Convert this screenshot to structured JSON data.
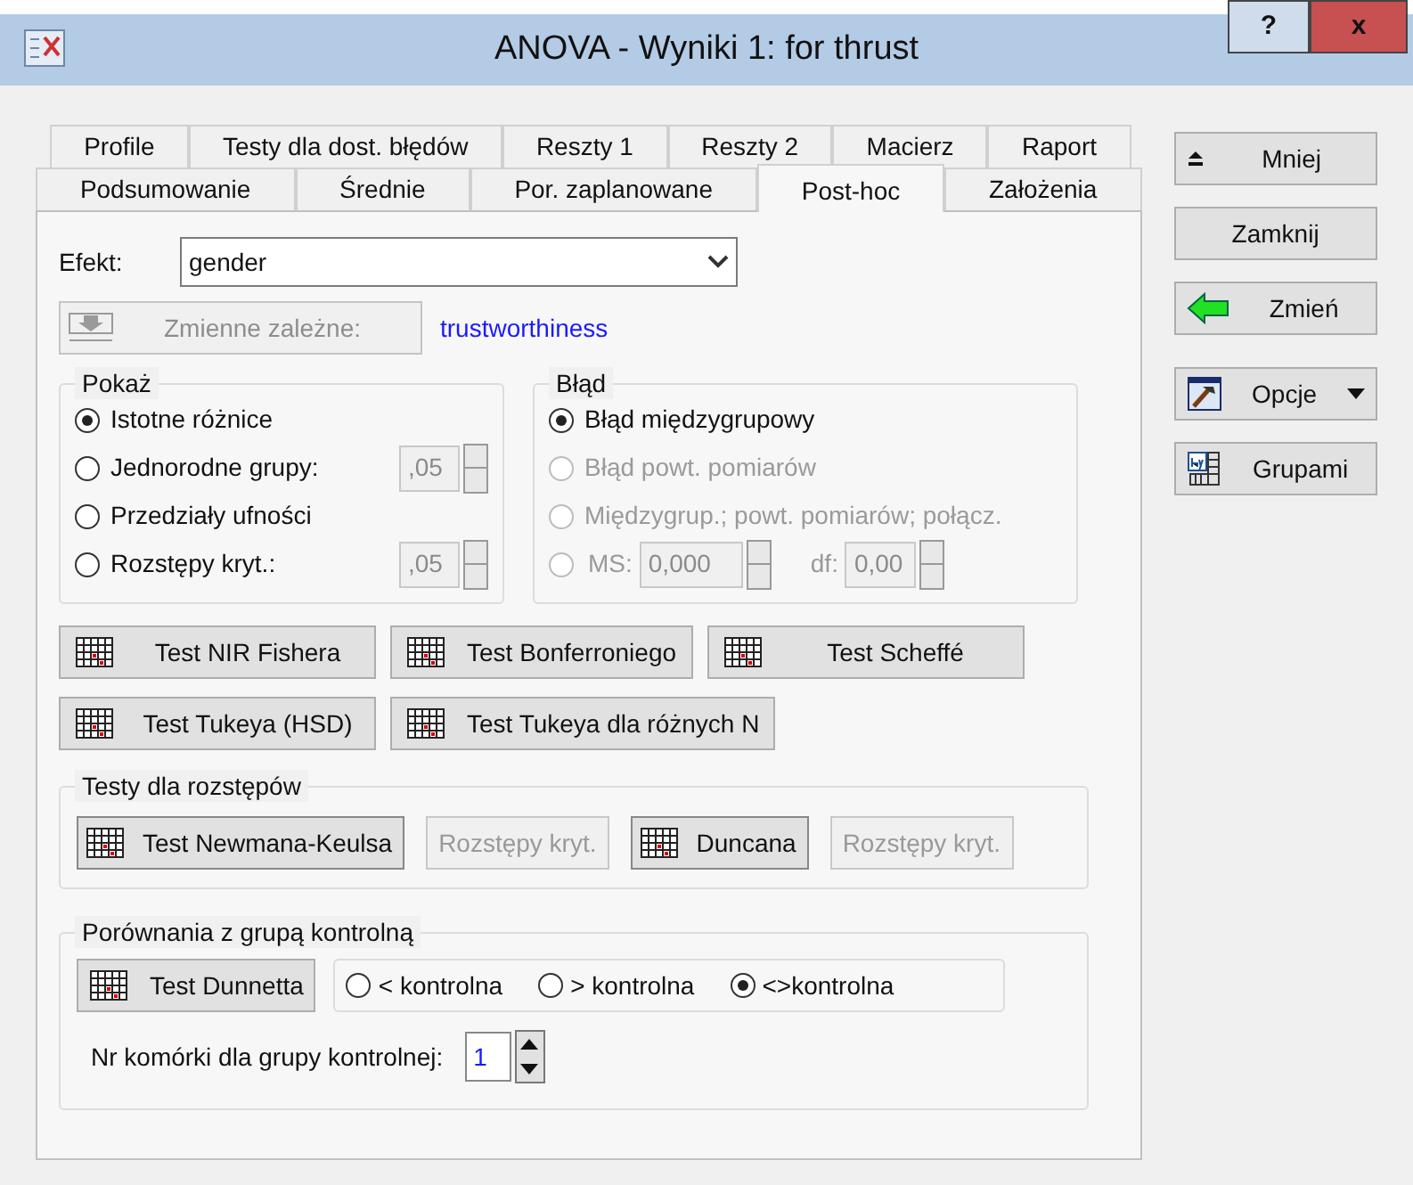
{
  "window": {
    "title": "ANOVA - Wyniki 1: for thrust",
    "help": "?",
    "close": "x"
  },
  "tab_rows": [
    [
      {
        "label": "Profile",
        "selected": false
      },
      {
        "label": "Testy dla dost. błędów",
        "selected": false
      },
      {
        "label": "Reszty 1",
        "selected": false
      },
      {
        "label": "Reszty 2",
        "selected": false
      },
      {
        "label": "Macierz",
        "selected": false
      },
      {
        "label": "Raport",
        "selected": false
      }
    ],
    [
      {
        "label": "Podsumowanie",
        "selected": false
      },
      {
        "label": "Średnie",
        "selected": false
      },
      {
        "label": "Por. zaplanowane",
        "selected": false
      },
      {
        "label": "Post-hoc",
        "selected": true
      },
      {
        "label": "Założenia",
        "selected": false
      }
    ]
  ],
  "effect": {
    "label": "Efekt:",
    "value": "gender"
  },
  "dependent": {
    "button": "Zmienne zależne:",
    "disabled": true,
    "value": "trustworthiness"
  },
  "show": {
    "title": "Pokaż",
    "options": [
      {
        "label": "Istotne różnice",
        "selected": true
      },
      {
        "label": "Jednorodne grupy:",
        "selected": false,
        "spin": ",05"
      },
      {
        "label": "Przedziały ufności",
        "selected": false
      },
      {
        "label": "Rozstępy kryt.:",
        "selected": false,
        "spin": ",05"
      }
    ]
  },
  "error": {
    "title": "Błąd",
    "options": [
      {
        "label": "Błąd międzygrupowy",
        "selected": true,
        "disabled": false
      },
      {
        "label": "Błąd powt. pomiarów",
        "selected": false,
        "disabled": true
      },
      {
        "label": "Międzygrup.; powt. pomiarów; połącz.",
        "selected": false,
        "disabled": true
      }
    ],
    "ms": {
      "selected": false,
      "label": "MS:",
      "value": "0,000",
      "df_label": "df:",
      "df_value": "0,00"
    }
  },
  "test_rows": [
    [
      "Test NIR Fishera",
      "Test Bonferroniego",
      "Test Scheffé"
    ],
    [
      "Test Tukeya (HSD)",
      "Test Tukeya dla różnych N"
    ]
  ],
  "range_tests": {
    "title": "Testy dla rozstępów",
    "buttons": [
      {
        "label": "Test Newmana-Keulsa",
        "kind": "icon",
        "disabled": false
      },
      {
        "label": "Rozstępy kryt.",
        "kind": "plain",
        "disabled": true
      },
      {
        "label": "Duncana",
        "kind": "icon",
        "disabled": false
      },
      {
        "label": "Rozstępy kryt.",
        "kind": "plain",
        "disabled": true
      }
    ]
  },
  "control": {
    "title": "Porównania z grupą kontrolną",
    "button": "Test Dunnetta",
    "options": [
      {
        "label": "< kontrolna",
        "selected": false
      },
      {
        "label": "> kontrolna",
        "selected": false
      },
      {
        "label": "<>kontrolna",
        "selected": true
      }
    ],
    "cell_label": "Nr komórki dla grupy kontrolnej:",
    "cell_value": "1"
  },
  "side_buttons": [
    {
      "label": "Mniej",
      "kind": "less"
    },
    {
      "label": "Zamknij",
      "kind": "plain"
    },
    {
      "label": "Zmień",
      "kind": "arrow"
    },
    {
      "label": "Opcje",
      "kind": "menu"
    },
    {
      "label": "Grupami",
      "kind": "groups"
    }
  ]
}
